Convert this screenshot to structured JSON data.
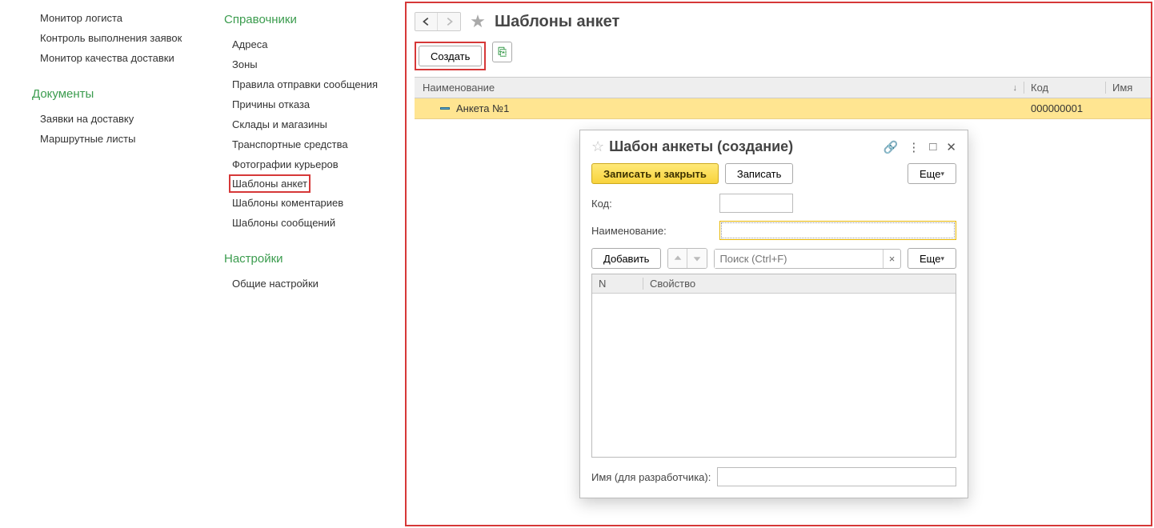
{
  "nav1": {
    "items": [
      "Монитор логиста",
      "Контроль выполнения заявок",
      "Монитор качества доставки"
    ],
    "docs_header": "Документы",
    "docs_items": [
      "Заявки на доставку",
      "Маршрутные листы"
    ]
  },
  "nav2": {
    "ref_header": "Справочники",
    "ref_items": [
      "Адреса",
      "Зоны",
      "Правила отправки сообщения",
      "Причины отказа",
      "Склады и магазины",
      "Транспортные средства",
      "Фотографии курьеров",
      "Шаблоны анкет",
      "Шаблоны коментариев",
      "Шаблоны сообщений"
    ],
    "settings_header": "Настройки",
    "settings_items": [
      "Общие настройки"
    ]
  },
  "main": {
    "title": "Шаблоны анкет",
    "create_label": "Создать",
    "columns": {
      "name": "Наименование",
      "code": "Код",
      "ima": "Имя"
    },
    "rows": [
      {
        "name": "Анкета №1",
        "code": "000000001",
        "ima": ""
      }
    ]
  },
  "dialog": {
    "title": "Шабон анкеты (создание)",
    "save_close_label": "Записать и закрыть",
    "save_label": "Записать",
    "more_label": "Еще",
    "code_label": "Код:",
    "code_value": "",
    "name_label": "Наименование:",
    "name_value": "",
    "add_label": "Добавить",
    "search_placeholder": "Поиск (Ctrl+F)",
    "grid_cols": {
      "n": "N",
      "prop": "Свойство"
    },
    "dev_label": "Имя (для разработчика):",
    "dev_value": ""
  }
}
